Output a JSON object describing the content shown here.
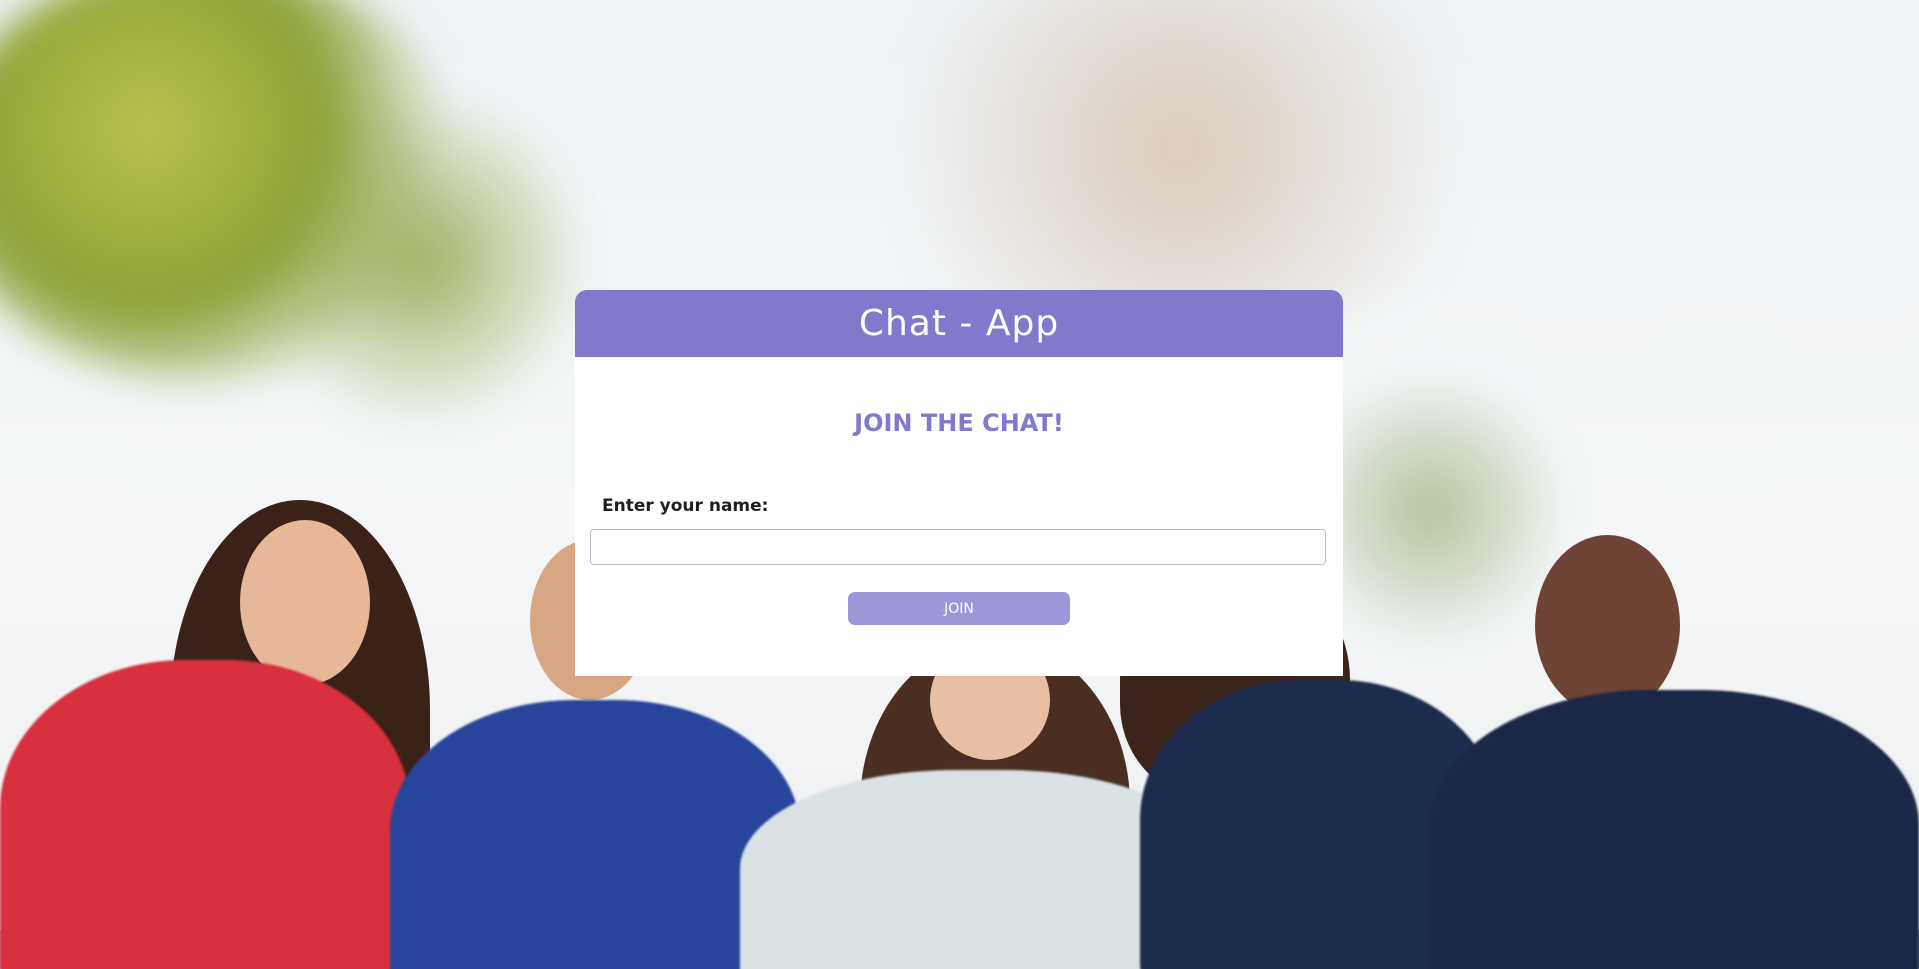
{
  "app": {
    "header_title": "Chat - App"
  },
  "join_form": {
    "heading": "JOIN THE CHAT!",
    "name_label": "Enter your name:",
    "name_value": "",
    "name_placeholder": "",
    "join_label": "JOIN"
  },
  "colors": {
    "accent": "#8279cd",
    "button": "#9d97d8",
    "card_bg": "#ffffff"
  }
}
